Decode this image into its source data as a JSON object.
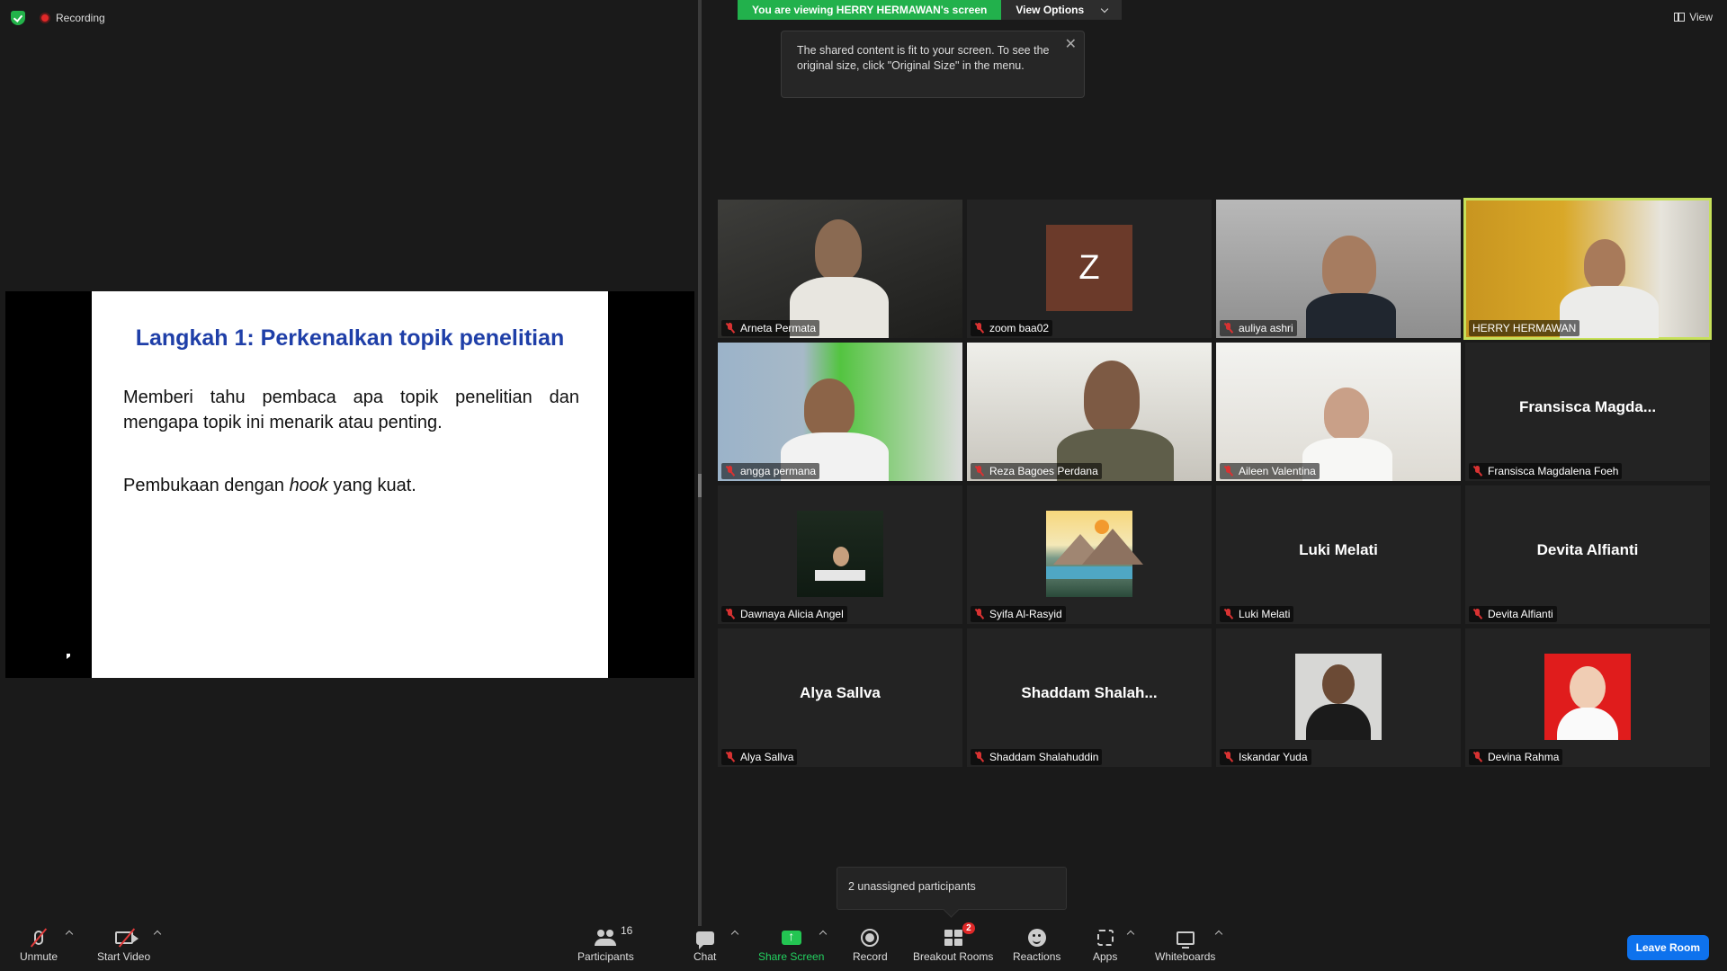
{
  "status": {
    "recording_label": "Recording"
  },
  "banner": {
    "viewing_text": "You are viewing HERRY HERMAWAN's screen",
    "view_options_label": "View Options"
  },
  "tooltip": {
    "text": "The shared content is fit to your screen. To see the original size, click \"Original Size\" in the menu."
  },
  "view_button": {
    "label": "View"
  },
  "slide": {
    "title": "Langkah 1: Perkenalkan topik penelitian",
    "paragraph1": "Memberi tahu pembaca apa topik penelitian dan mengapa topik ini menarik atau penting.",
    "paragraph2_before": "Pembukaan dengan ",
    "paragraph2_italic": "hook",
    "paragraph2_after": " yang kuat."
  },
  "participants": [
    {
      "name": "Arneta Permata",
      "big_name": "",
      "avatar": "",
      "muted": true
    },
    {
      "name": "zoom baa02",
      "big_name": "",
      "avatar": "Z",
      "muted": true
    },
    {
      "name": "auliya ashri",
      "big_name": "",
      "avatar": "",
      "muted": true
    },
    {
      "name": "HERRY HERMAWAN",
      "big_name": "",
      "avatar": "",
      "muted": false
    },
    {
      "name": "angga permana",
      "big_name": "",
      "avatar": "",
      "muted": true
    },
    {
      "name": "Reza Bagoes Perdana",
      "big_name": "",
      "avatar": "",
      "muted": true
    },
    {
      "name": "Aileen Valentina",
      "big_name": "",
      "avatar": "",
      "muted": true
    },
    {
      "name": "Fransisca Magdalena Foeh",
      "big_name": "Fransisca  Magda...",
      "avatar": "",
      "muted": true
    },
    {
      "name": "Dawnaya Alicia Angel",
      "big_name": "",
      "avatar": "",
      "muted": true
    },
    {
      "name": "Syifa Al-Rasyid",
      "big_name": "",
      "avatar": "",
      "muted": true
    },
    {
      "name": "Luki Melati",
      "big_name": "Luki Melati",
      "avatar": "",
      "muted": true
    },
    {
      "name": "Devita Alfianti",
      "big_name": "Devita Alfianti",
      "avatar": "",
      "muted": true
    },
    {
      "name": "Alya Sallva",
      "big_name": "Alya Sallva",
      "avatar": "",
      "muted": true
    },
    {
      "name": "Shaddam Shalahuddin",
      "big_name": "Shaddam  Shalah...",
      "avatar": "",
      "muted": true
    },
    {
      "name": "Iskandar Yuda",
      "big_name": "",
      "avatar": "",
      "muted": true
    },
    {
      "name": "Devina Rahma",
      "big_name": "",
      "avatar": "",
      "muted": true
    }
  ],
  "unassigned": {
    "text": "2 unassigned participants"
  },
  "toolbar": {
    "unmute": "Unmute",
    "start_video": "Start Video",
    "participants": "Participants",
    "participants_count": "16",
    "chat": "Chat",
    "share_screen": "Share Screen",
    "record": "Record",
    "breakout_rooms": "Breakout Rooms",
    "breakout_badge": "2",
    "reactions": "Reactions",
    "apps": "Apps",
    "whiteboards": "Whiteboards",
    "leave_room": "Leave Room"
  },
  "colors": {
    "accent_green": "#22b14c",
    "active_speaker": "#c6e05a",
    "leave_blue": "#0e72ed",
    "muted_red": "#d83232"
  }
}
